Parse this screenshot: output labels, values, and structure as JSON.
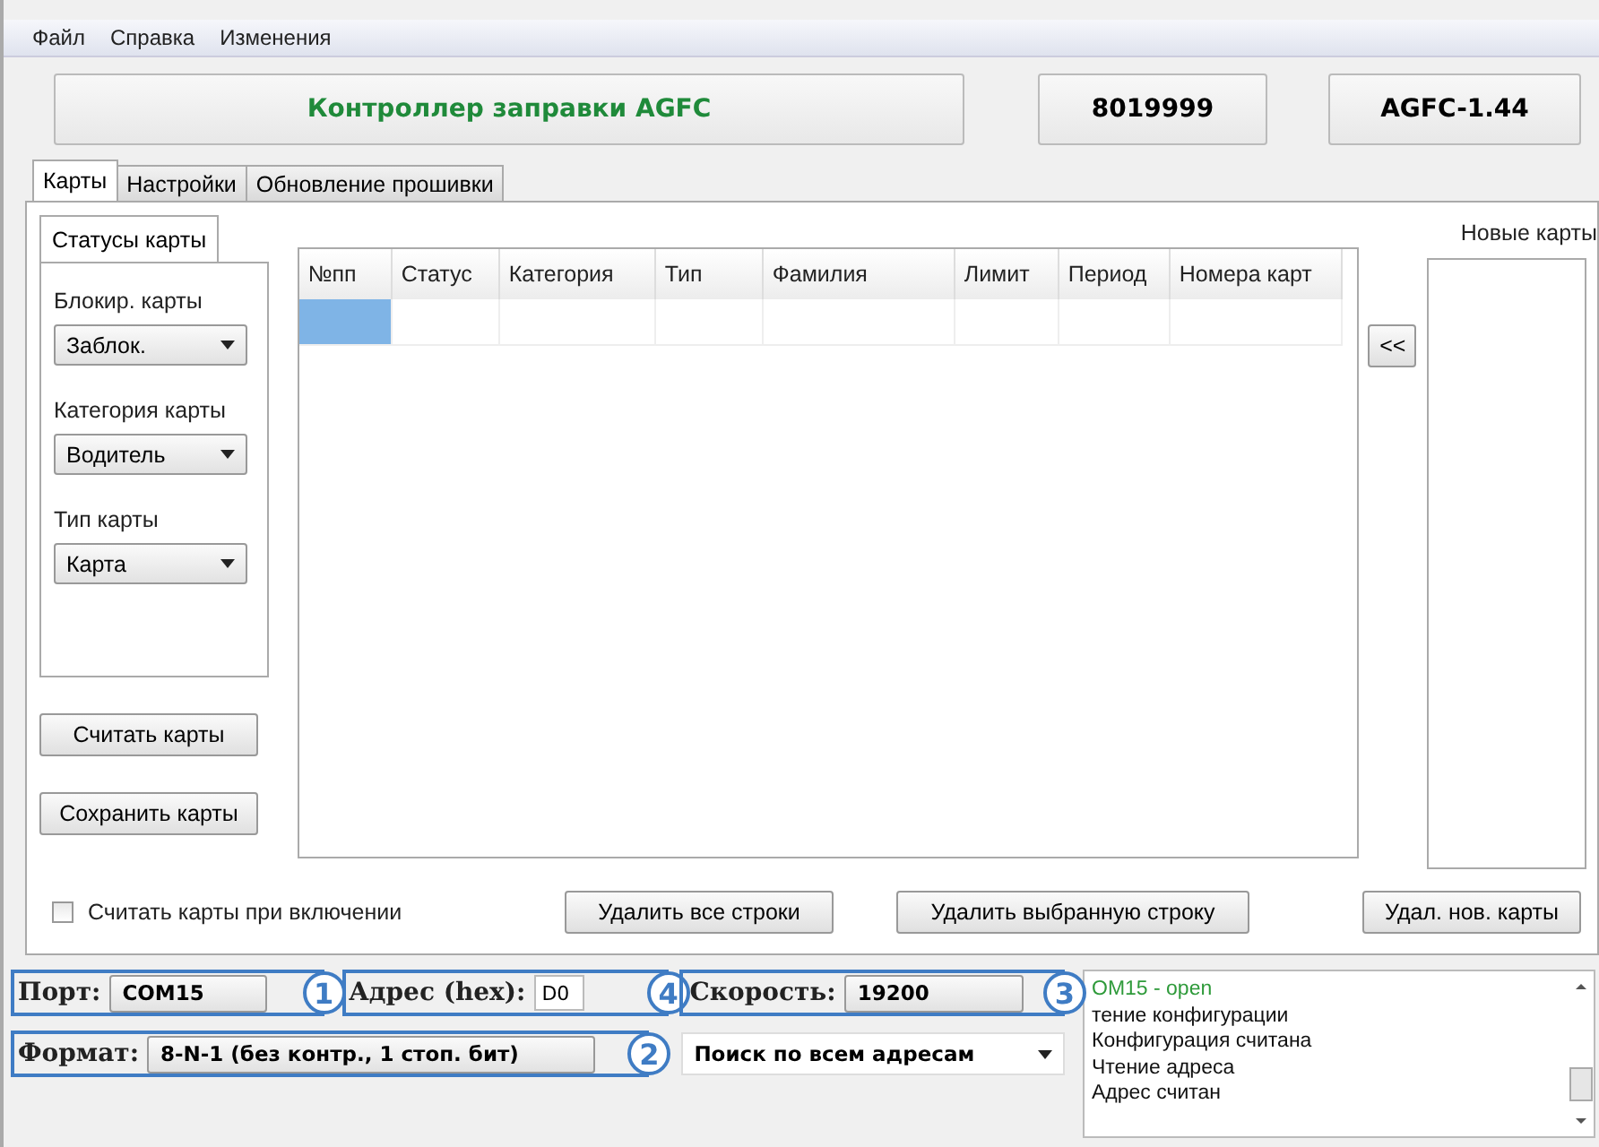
{
  "menu": [
    "Файл",
    "Справка",
    "Изменения"
  ],
  "header": {
    "title": "Контроллер заправки AGFC",
    "serial": "8019999",
    "version": "AGFC-1.44"
  },
  "tabs": [
    {
      "label": "Карты",
      "selected": true
    },
    {
      "label": "Настройки",
      "selected": false
    },
    {
      "label": "Обновление прошивки",
      "selected": false
    }
  ],
  "subtab": "Статусы карты",
  "filters": [
    {
      "label": "Блокир. карты",
      "value": "Заблок."
    },
    {
      "label": "Категория карты",
      "value": "Водитель"
    },
    {
      "label": "Тип карты",
      "value": "Карта"
    }
  ],
  "side_buttons": [
    "Считать карты",
    "Сохранить карты"
  ],
  "table": {
    "columns": [
      "№пп",
      "Статус",
      "Категория",
      "Тип",
      "Фамилия",
      "Лимит",
      "Период",
      "Номера карт"
    ],
    "rows": [
      {
        "selected": true
      }
    ]
  },
  "move_button": "<<",
  "new_cards": {
    "title": "Новые карты"
  },
  "autoread": {
    "label": "Считать карты при включении",
    "checked": false
  },
  "action_buttons": [
    "Удалить все строки",
    "Удалить выбранную строку",
    "Удал. нов. карты"
  ],
  "connection": {
    "port": {
      "label": "Порт:",
      "value": "COM15",
      "callout": "1"
    },
    "address": {
      "label": "Адрес (hex):",
      "value": "D0",
      "callout": "4"
    },
    "speed": {
      "label": "Скорость:",
      "value": "19200",
      "callout": "3"
    },
    "format": {
      "label": "Формат:",
      "value": "8-N-1 (без контр., 1 стоп. бит)",
      "callout": "2"
    },
    "search_mode": "Поиск по всем адресам"
  },
  "log": [
    {
      "text": "OM15 - open",
      "kind": "success"
    },
    {
      "text": "тение конфигурации",
      "kind": "info"
    },
    {
      "text": "Конфигурация считана",
      "kind": "info"
    },
    {
      "text": "Чтение адреса",
      "kind": "info"
    },
    {
      "text": "Адрес считан",
      "kind": "info"
    }
  ]
}
